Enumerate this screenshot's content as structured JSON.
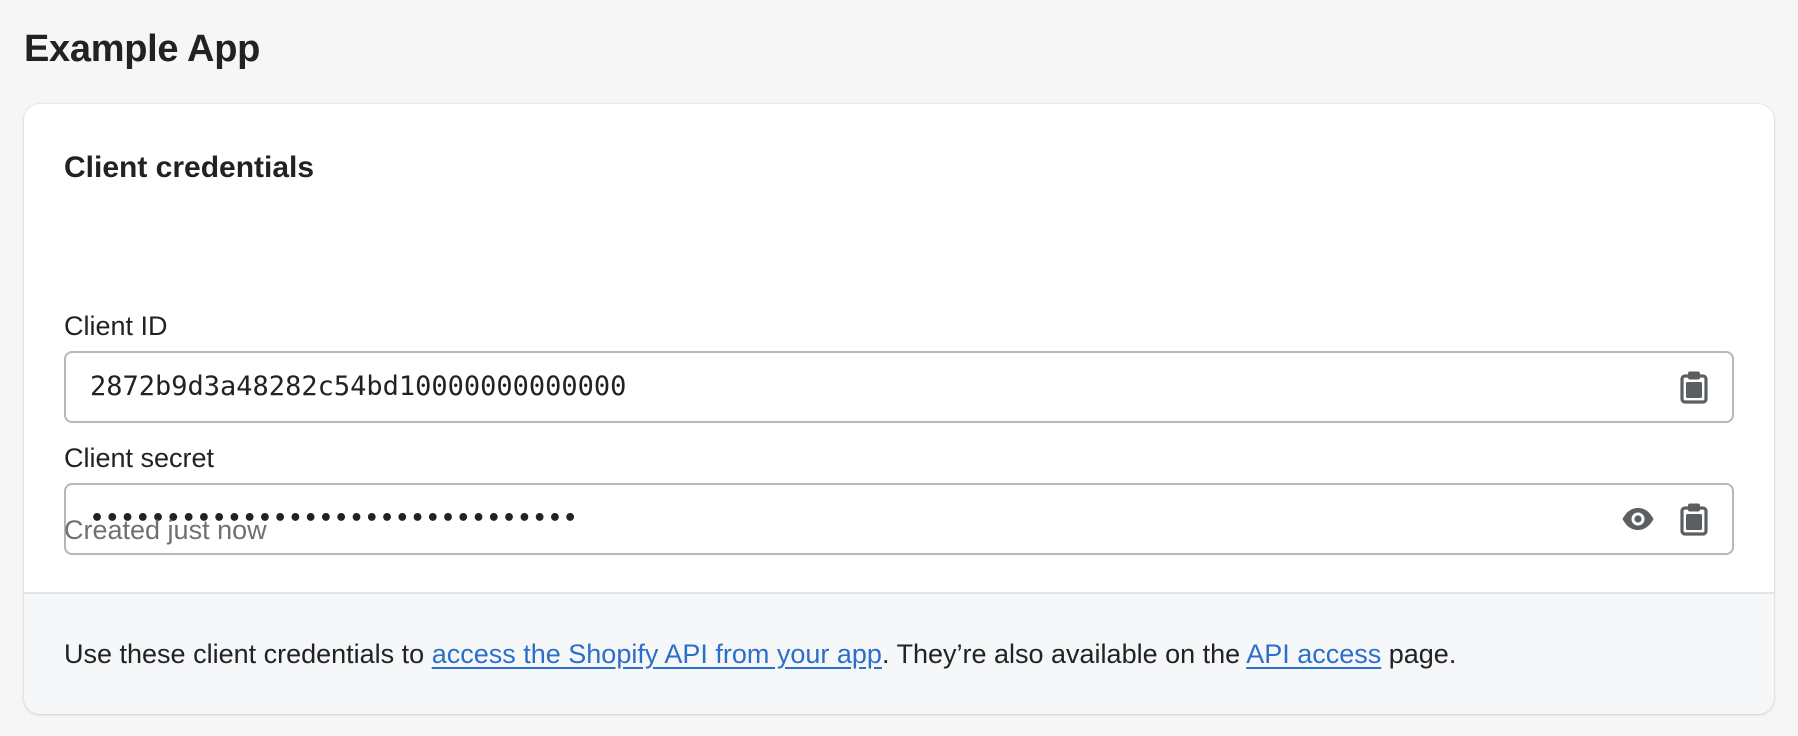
{
  "page": {
    "title": "Example App"
  },
  "card": {
    "heading": "Client credentials",
    "client_id": {
      "label": "Client ID",
      "value": "2872b9d3a48282c54bd10000000000000",
      "copy_icon": "clipboard-icon"
    },
    "client_secret": {
      "label": "Client secret",
      "value": "••••••••••••••••••••••••••••••••",
      "reveal_icon": "eye-icon",
      "copy_icon": "clipboard-icon",
      "hint": "Created just now"
    },
    "footer": {
      "text_before": "Use these client credentials to ",
      "link1": "access the Shopify API from your app",
      "text_middle": ". They’re also available on the ",
      "link2": "API access",
      "text_after": " page."
    }
  },
  "colors": {
    "background": "#f6f6f7",
    "card": "#ffffff",
    "link": "#2c6ecb",
    "muted_text": "#6d7175",
    "border": "#b5b8bb"
  }
}
